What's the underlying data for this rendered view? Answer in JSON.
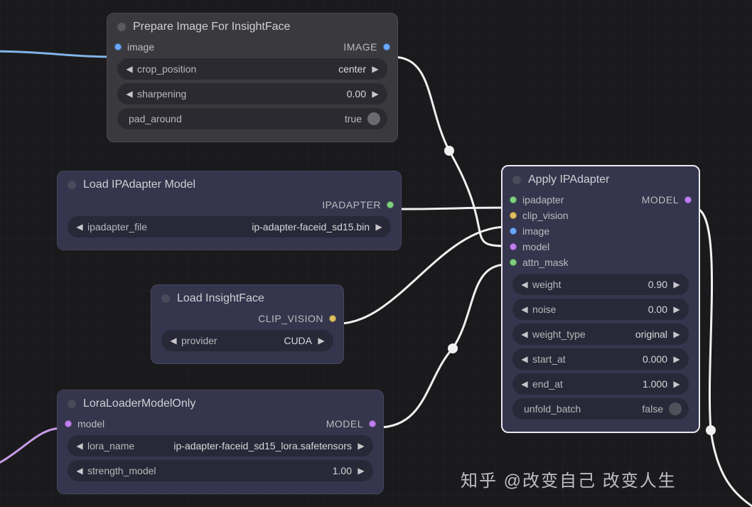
{
  "nodes": {
    "prepare": {
      "title": "Prepare Image For InsightFace",
      "inputs": {
        "image": "image"
      },
      "outputs": {
        "image": "IMAGE"
      },
      "widgets": {
        "crop_position": {
          "label": "crop_position",
          "value": "center"
        },
        "sharpening": {
          "label": "sharpening",
          "value": "0.00"
        },
        "pad_around": {
          "label": "pad_around",
          "value": "true"
        }
      }
    },
    "loadipa": {
      "title": "Load IPAdapter Model",
      "outputs": {
        "ipadapter": "IPADAPTER"
      },
      "widgets": {
        "ipadapter_file": {
          "label": "ipadapter_file",
          "value": "ip-adapter-faceid_sd15.bin"
        }
      }
    },
    "insight": {
      "title": "Load InsightFace",
      "outputs": {
        "clip_vision": "CLIP_VISION"
      },
      "widgets": {
        "provider": {
          "label": "provider",
          "value": "CUDA"
        }
      }
    },
    "lora": {
      "title": "LoraLoaderModelOnly",
      "inputs": {
        "model": "model"
      },
      "outputs": {
        "model": "MODEL"
      },
      "widgets": {
        "lora_name": {
          "label": "lora_name",
          "value": "ip-adapter-faceid_sd15_lora.safetensors"
        },
        "strength_model": {
          "label": "strength_model",
          "value": "1.00"
        }
      }
    },
    "apply": {
      "title": "Apply IPAdapter",
      "inputs": {
        "ipadapter": "ipadapter",
        "clip_vision": "clip_vision",
        "image": "image",
        "model": "model",
        "attn_mask": "attn_mask"
      },
      "outputs": {
        "model": "MODEL"
      },
      "widgets": {
        "weight": {
          "label": "weight",
          "value": "0.90"
        },
        "noise": {
          "label": "noise",
          "value": "0.00"
        },
        "weight_type": {
          "label": "weight_type",
          "value": "original"
        },
        "start_at": {
          "label": "start_at",
          "value": "0.000"
        },
        "end_at": {
          "label": "end_at",
          "value": "1.000"
        },
        "unfold_batch": {
          "label": "unfold_batch",
          "value": "false"
        }
      }
    }
  },
  "watermark": "知乎 @改变自己 改变人生"
}
